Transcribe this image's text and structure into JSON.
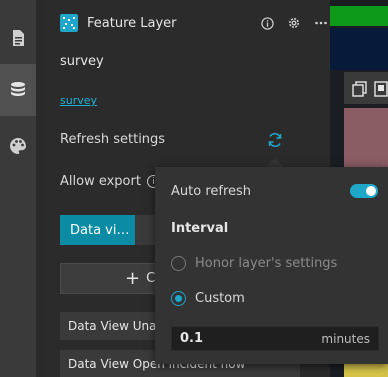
{
  "rail": {
    "items": [
      {
        "icon": "document-icon"
      },
      {
        "icon": "database-icon",
        "active": true
      },
      {
        "icon": "palette-icon"
      }
    ]
  },
  "header": {
    "title": "Feature Layer",
    "icons": [
      "info-icon",
      "settings-gear-icon",
      "more-horizontal-icon"
    ]
  },
  "layer": {
    "name": "survey",
    "link_text": "survey"
  },
  "settings": {
    "refresh_label": "Refresh settings",
    "allow_export_label": "Allow export",
    "info_glyph": "i"
  },
  "tabs": {
    "active_label": "Data vi…"
  },
  "create_button": {
    "icon": "+",
    "label": "C"
  },
  "data_views": [
    {
      "label": "Data View Una"
    },
    {
      "label": "Data View Open incident now"
    }
  ],
  "popover": {
    "auto_refresh_label": "Auto refresh",
    "auto_refresh_on": true,
    "interval_title": "Interval",
    "options": [
      {
        "label": "Honor layer's settings",
        "checked": false,
        "disabled": true
      },
      {
        "label": "Custom",
        "checked": true,
        "disabled": false
      }
    ],
    "interval_value": "0.1",
    "interval_unit": "minutes"
  },
  "colors": {
    "accent": "#1fa7c9",
    "tab_active": "#0c8ba4",
    "link": "#1fb3d6"
  }
}
